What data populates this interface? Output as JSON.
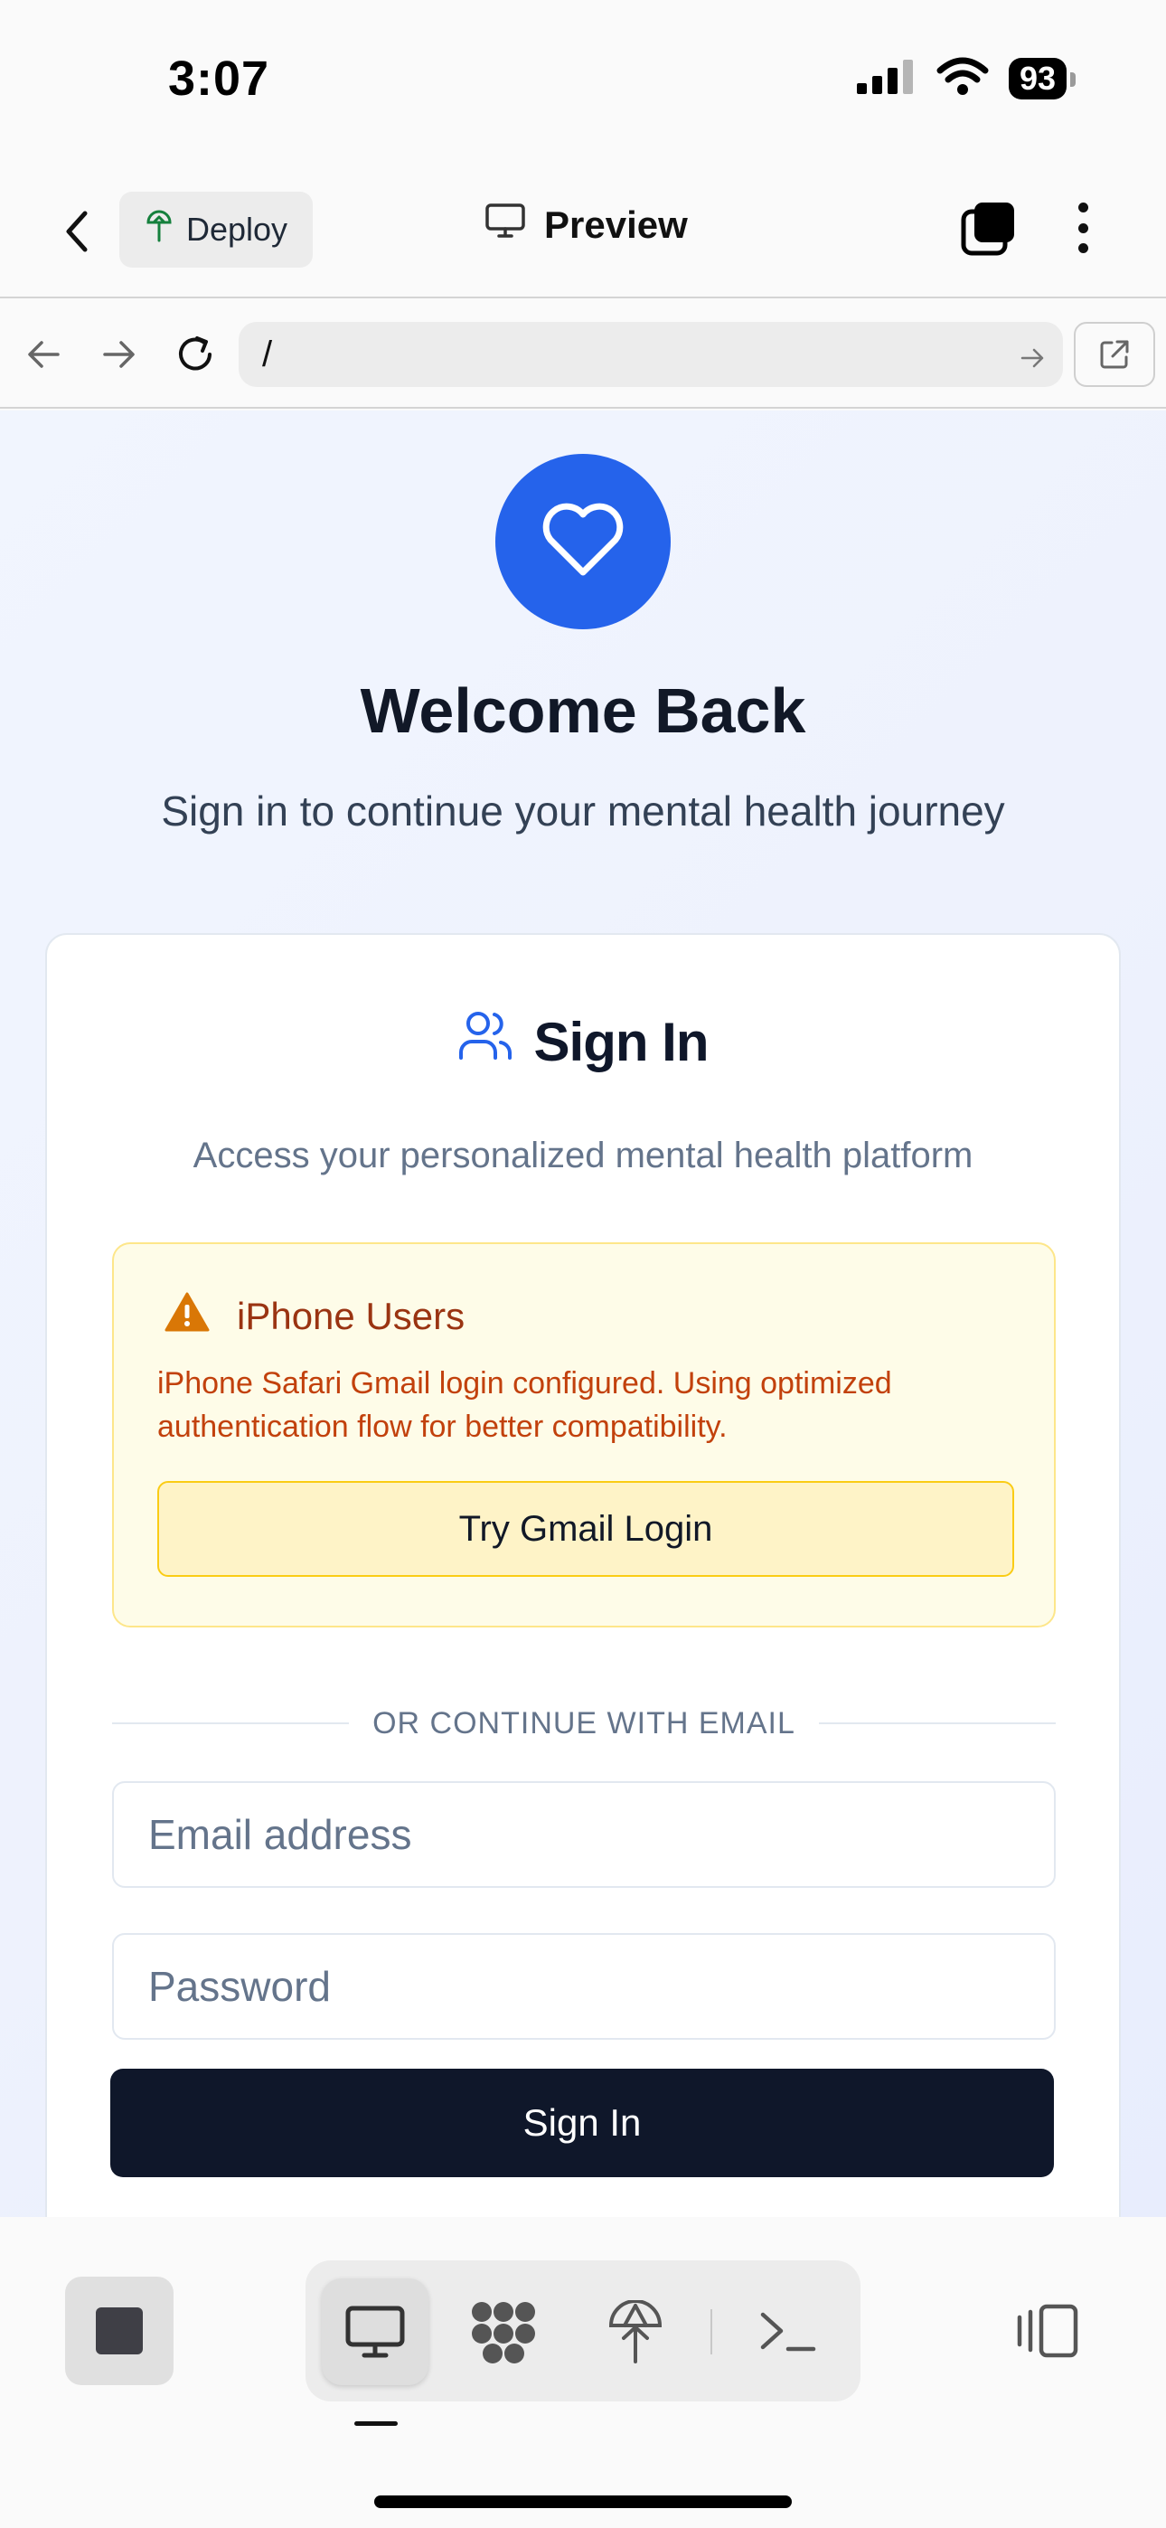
{
  "status_bar": {
    "time": "3:07",
    "battery": "93",
    "icons": [
      "signal-icon",
      "wifi-icon",
      "battery-icon"
    ]
  },
  "app_header": {
    "deploy_label": "Deploy",
    "preview_label": "Preview",
    "icons": [
      "back-chevron-icon",
      "deploy-icon",
      "monitor-icon",
      "tabs-icon",
      "more-vertical-icon"
    ]
  },
  "url_bar": {
    "url": "/",
    "icons": [
      "back-arrow-icon",
      "forward-arrow-icon",
      "reload-icon",
      "go-arrow-icon",
      "external-link-icon"
    ]
  },
  "page": {
    "logo_icon": "heart-icon",
    "title": "Welcome Back",
    "subtitle": "Sign in to continue your mental health journey"
  },
  "card": {
    "title": "Sign In",
    "title_icon": "users-icon",
    "description": "Access your personalized mental health platform",
    "alert": {
      "title": "iPhone Users",
      "icon": "warning-icon",
      "text": "iPhone Safari Gmail login configured. Using optimized authentication flow for better compatibility.",
      "button_label": "Try Gmail Login"
    },
    "divider_label": "OR CONTINUE WITH EMAIL",
    "email_placeholder": "Email address",
    "password_placeholder": "Password",
    "signin_label": "Sign In"
  },
  "bottom_toolbar": {
    "items": [
      "stop-icon",
      "desktop-icon",
      "workflow-icon",
      "deploy-icon",
      "terminal-icon",
      "layout-icon"
    ],
    "active": "desktop-icon"
  },
  "colors": {
    "accent": "#2563eb",
    "alert_bg": "#fefce8",
    "alert_border": "#fde68a",
    "alert_text": "#c2410c",
    "primary_button": "#0f172a"
  }
}
